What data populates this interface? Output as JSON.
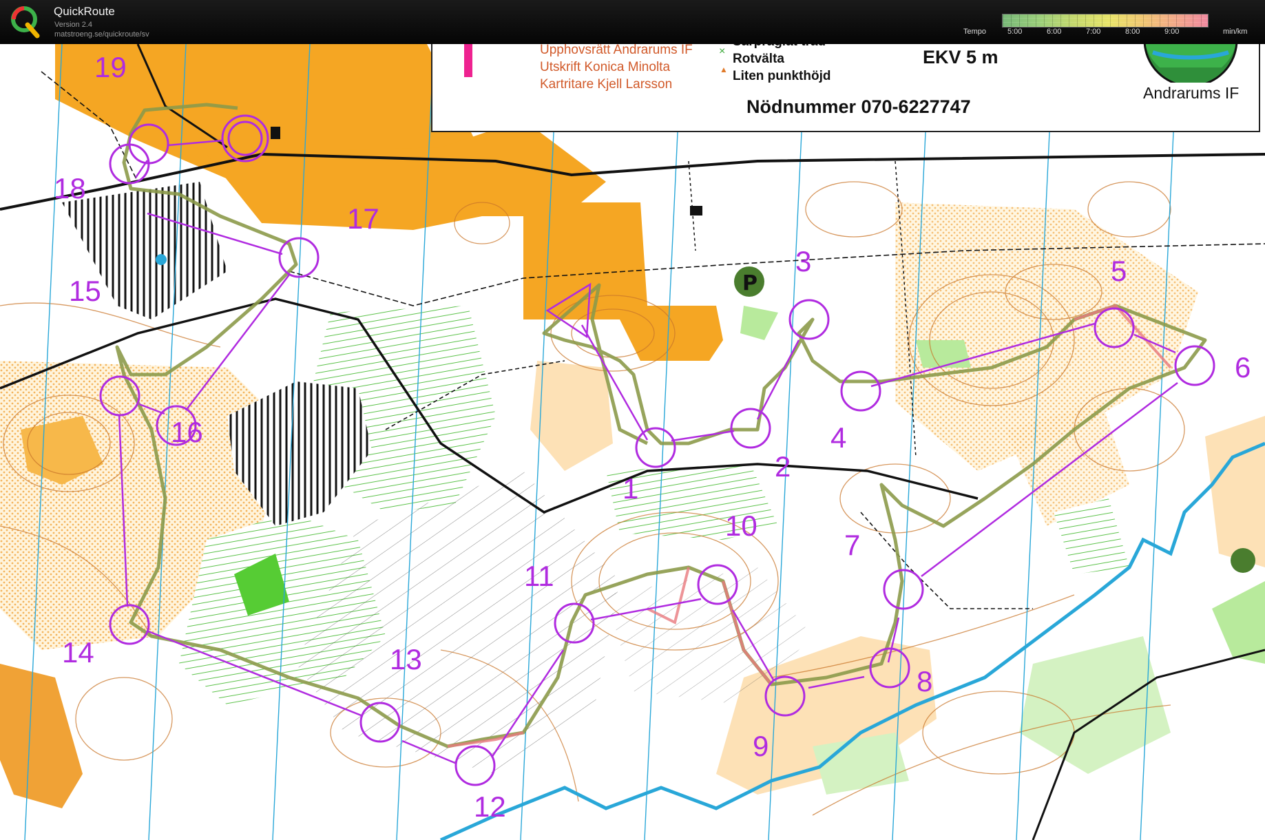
{
  "app": {
    "name": "QuickRoute",
    "version": "Version 2.4",
    "url": "matstroeng.se/quickroute/sv",
    "logo_letter": "Q"
  },
  "pace_scale": {
    "label": "Tempo",
    "unit": "min/km",
    "ticks": [
      "5:00",
      "6:00",
      "7:00",
      "8:00",
      "9:00"
    ]
  },
  "map_legend": {
    "copyright": "Upphovsrätt Andrarums IF",
    "print": "Utskrift Konica Minolta",
    "cartographer": "Kartritare Kjell Larsson",
    "sym_tree": "Särpräglat träd",
    "sym_rootstock": "Rotvälta",
    "sym_knoll": "Liten punkthöjd",
    "contour_interval": "EKV 5 m",
    "emergency": "Nödnummer 070-6227747",
    "club": "Andrarums IF"
  },
  "course": {
    "controls": [
      "1",
      "2",
      "3",
      "4",
      "5",
      "6",
      "7",
      "8",
      "9",
      "10",
      "11",
      "12",
      "13",
      "14",
      "15",
      "16",
      "17",
      "18",
      "19"
    ],
    "colors": {
      "course": "#b02be0",
      "route": "#8c9a4a",
      "water": "#29a7d8",
      "open": "#f5a623"
    }
  }
}
